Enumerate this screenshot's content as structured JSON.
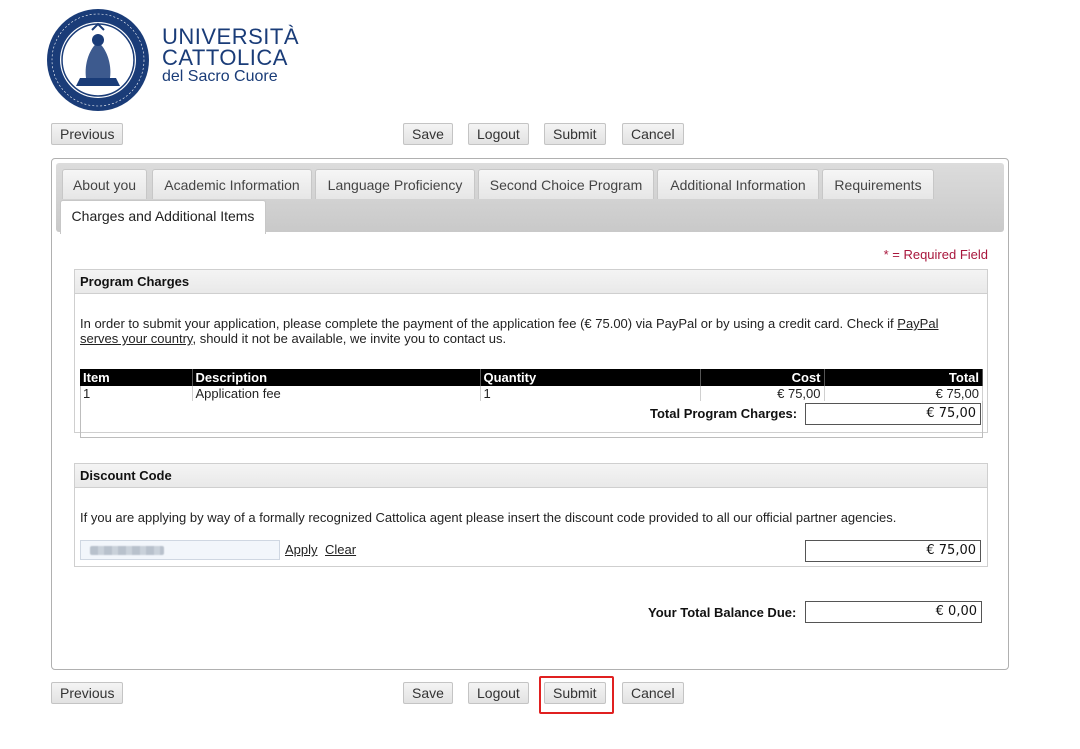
{
  "header": {
    "logo_line1": "UNIVERSITÀ",
    "logo_line2": "CATTOLICA",
    "logo_line3": "del Sacro Cuore",
    "seal_icon": "university-seal-icon",
    "brand_color": "#1a3c78"
  },
  "toolbar_top": {
    "previous": "Previous",
    "save": "Save",
    "logout": "Logout",
    "submit": "Submit",
    "cancel": "Cancel"
  },
  "toolbar_bottom": {
    "previous": "Previous",
    "save": "Save",
    "logout": "Logout",
    "submit": "Submit",
    "cancel": "Cancel"
  },
  "tabs": [
    {
      "label": "About you"
    },
    {
      "label": "Academic Information"
    },
    {
      "label": "Language Proficiency"
    },
    {
      "label": "Second Choice Program"
    },
    {
      "label": "Additional Information"
    },
    {
      "label": "Requirements"
    },
    {
      "label": "Charges and Additional Items",
      "active": true
    }
  ],
  "required_note": "* = Required Field",
  "program_charges": {
    "title": "Program Charges",
    "intro_before_link": "In order to submit your application, please complete the payment of the application fee (€ 75.00) via PayPal or by using a credit card. Check if ",
    "link_text_1": "PayPal",
    "link_text_2": "serves your country",
    "intro_after_link": ", should it not be available, we invite you to contact us.",
    "columns": [
      "Item",
      "Description",
      "Quantity",
      "Cost",
      "Total"
    ],
    "rows": [
      {
        "item": "1",
        "description": "Application fee",
        "quantity": "1",
        "cost": "€ 75,00",
        "total": "€ 75,00"
      }
    ],
    "total_label": "Total Program Charges:",
    "total_value": "€ 75,00"
  },
  "discount": {
    "title": "Discount Code",
    "text": "If you are applying by way of a formally recognized Cattolica agent please insert the discount code provided to all our official partner agencies.",
    "apply": "Apply",
    "clear": "Clear",
    "amount": "€ 75,00"
  },
  "balance": {
    "label": "Your Total Balance Due:",
    "value": "€ 0,00"
  },
  "colors": {
    "required": "#a8163c",
    "highlight": "#e02020"
  }
}
